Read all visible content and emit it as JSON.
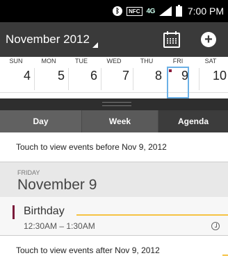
{
  "status_bar": {
    "bluetooth": "bluetooth-icon",
    "nfc_label": "NFC",
    "network_label": "4G",
    "time": "7:00 PM"
  },
  "header": {
    "month_title": "November 2012",
    "today_icon": "calendar-icon",
    "add_icon": "plus-icon",
    "background": "#3a3a3a"
  },
  "week": {
    "day_names": [
      "SUN",
      "MON",
      "TUE",
      "WED",
      "THU",
      "FRI",
      "SAT"
    ],
    "dates": [
      "4",
      "5",
      "6",
      "7",
      "8",
      "9",
      "10"
    ],
    "selected_index": 5
  },
  "tabs": {
    "day": "Day",
    "week": "Week",
    "agenda": "Agenda",
    "active": "agenda"
  },
  "agenda": {
    "touch_before": "Touch to view events before Nov 9, 2012",
    "day_weekday": "FRIDAY",
    "day_date": "November 9",
    "event": {
      "title": "Birthday",
      "time": "12:30AM – 1:30AM",
      "color": "#7a1a3a",
      "has_reminder": true
    },
    "touch_after": "Touch to view events after Nov 9, 2012"
  }
}
